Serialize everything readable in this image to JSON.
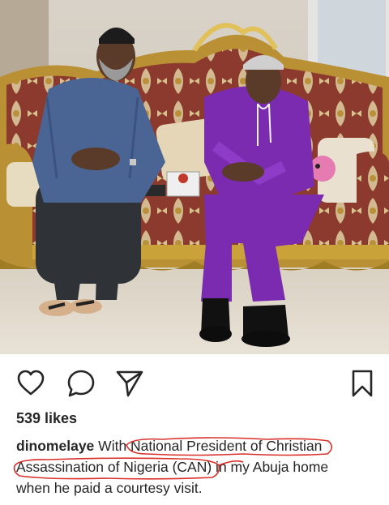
{
  "post": {
    "photo_alt": "Two men seated on an ornate gold-framed sofa",
    "likes_text": "539 likes",
    "username": "dinomelaye",
    "caption_line1": "With National President of Christian",
    "caption_line2": "Assassination of Nigeria (CAN) in my Abuja home",
    "caption_line3": "when he paid a courtesy visit."
  },
  "icons": {
    "like": "heart-icon",
    "comment": "comment-icon",
    "share": "send-icon",
    "save": "bookmark-icon"
  },
  "colors": {
    "text": "#262626",
    "annotation_red": "#d9302c",
    "purple_attire": "#7a2bb0",
    "sofa_gold": "#c9a23a"
  }
}
